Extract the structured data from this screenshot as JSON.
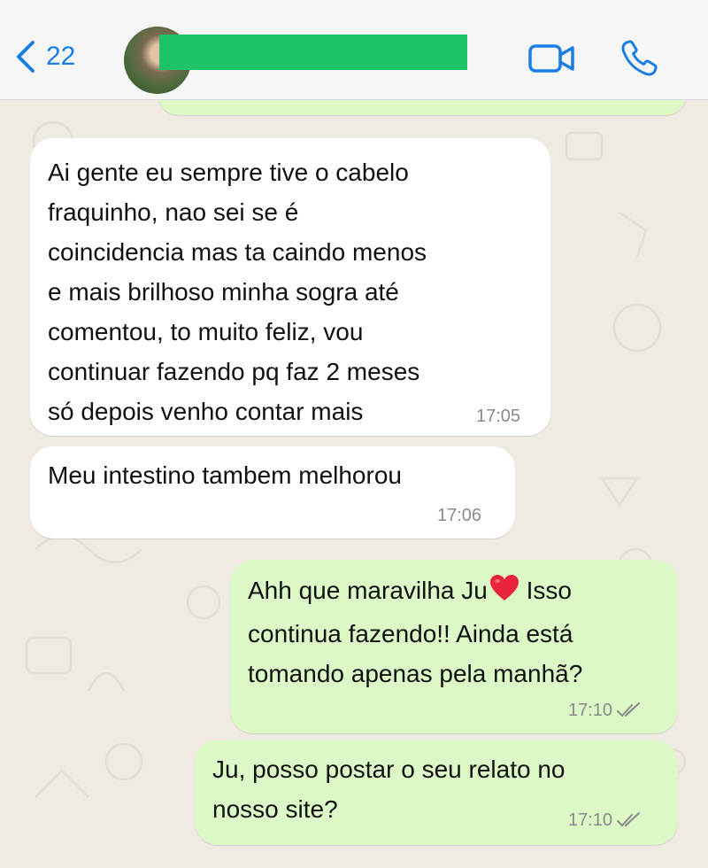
{
  "header": {
    "back_count": "22",
    "contact_name_redacted": true
  },
  "messages": [
    {
      "direction": "incoming",
      "text": "Ai gente eu sempre tive o cabelo\nfraquinho, nao sei se é\ncoincidencia mas ta caindo menos\ne mais brilhoso minha sogra até\ncomentou, to muito feliz, vou\ncontinuar fazendo pq faz 2 meses\nsó depois venho contar mais",
      "time": "17:05"
    },
    {
      "direction": "incoming",
      "text": "Meu intestino tambem melhorou",
      "time": "17:06"
    },
    {
      "direction": "outgoing",
      "text_before_emoji": "Ahh que maravilha Ju",
      "text_after_emoji": " Isso",
      "text_rest": "continua fazendo!! Ainda está\ntomando apenas pela manhã?",
      "emoji": "red-heart",
      "time": "17:10"
    },
    {
      "direction": "outgoing",
      "text": "Ju, posso postar o seu relato no\nnosso site?",
      "time": "17:10"
    }
  ],
  "colors": {
    "accent": "#1a7ee5",
    "outgoing_bubble": "#dcf8c6",
    "incoming_bubble": "#ffffff",
    "background": "#efeae2",
    "redaction": "#1ec368",
    "read_ticks": "#8a8a8a"
  }
}
